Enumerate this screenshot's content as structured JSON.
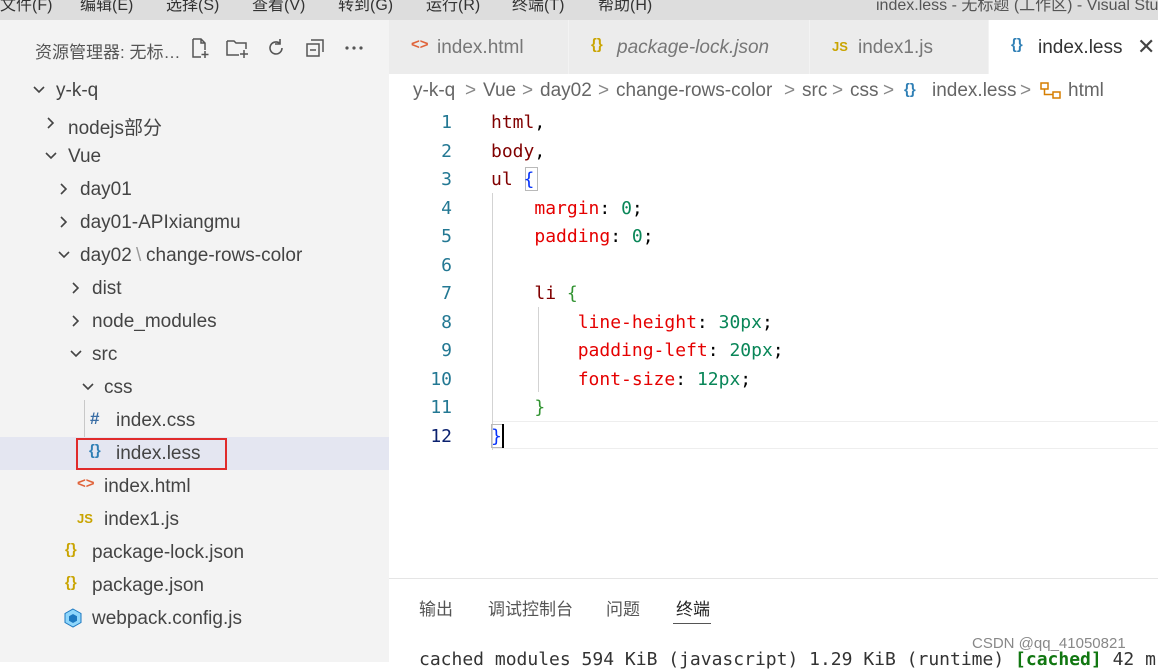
{
  "menubar": {
    "items": [
      "文件(F)",
      "编辑(E)",
      "选择(S)",
      "查看(V)",
      "转到(G)",
      "运行(R)",
      "终端(T)",
      "帮助(H)"
    ],
    "window_title": "index.less - 无标题 (工作区) - Visual Studio Code"
  },
  "explorer": {
    "title": "资源管理器: 无标…",
    "actions": [
      "new-file",
      "new-folder",
      "refresh",
      "collapse-all",
      "more"
    ],
    "tree": [
      {
        "label": "y-k-q",
        "type": "folder",
        "expanded": true
      },
      {
        "label": "nodejs部分",
        "type": "folder",
        "expanded": false
      },
      {
        "label": "Vue",
        "type": "folder",
        "expanded": true
      },
      {
        "label": "day01",
        "type": "folder",
        "expanded": false
      },
      {
        "label": "day01-APIxiangmu",
        "type": "folder",
        "expanded": false
      },
      {
        "label": "day02",
        "label_suffix": "change-rows-color",
        "type": "folder",
        "expanded": true
      },
      {
        "label": "dist",
        "type": "folder",
        "expanded": false
      },
      {
        "label": "node_modules",
        "type": "folder",
        "expanded": false
      },
      {
        "label": "src",
        "type": "folder",
        "expanded": true
      },
      {
        "label": "css",
        "type": "folder",
        "expanded": true
      },
      {
        "label": "index.css",
        "type": "file",
        "icon": "#"
      },
      {
        "label": "index.less",
        "type": "file",
        "icon": "{}",
        "selected": true
      },
      {
        "label": "index.html",
        "type": "file",
        "icon": "<>"
      },
      {
        "label": "index1.js",
        "type": "file",
        "icon": "JS"
      },
      {
        "label": "package-lock.json",
        "type": "file",
        "icon": "{}"
      },
      {
        "label": "package.json",
        "type": "file",
        "icon": "{}"
      },
      {
        "label": "webpack.config.js",
        "type": "file",
        "icon": "webpack"
      }
    ]
  },
  "tabs": [
    {
      "label": "index.html",
      "icon": "<>",
      "active": false
    },
    {
      "label": "package-lock.json",
      "icon": "{}",
      "active": false
    },
    {
      "label": "index1.js",
      "icon": "JS",
      "active": false
    },
    {
      "label": "index.less",
      "icon": "{}",
      "active": true,
      "close": "✕"
    }
  ],
  "breadcrumb": [
    "y-k-q",
    "Vue",
    "day02",
    "change-rows-color",
    "src",
    "css",
    "index.less",
    "html"
  ],
  "breadcrumb_icons": {
    "file": "{}",
    "symbol": "symbol-class"
  },
  "editor": {
    "lines": [
      {
        "n": "1",
        "tokens": [
          [
            "sel",
            "html"
          ],
          [
            "pun",
            ","
          ]
        ]
      },
      {
        "n": "2",
        "tokens": [
          [
            "sel",
            "body"
          ],
          [
            "pun",
            ","
          ]
        ]
      },
      {
        "n": "3",
        "tokens": [
          [
            "sel",
            "ul"
          ],
          [
            "pun",
            " "
          ],
          [
            "br1",
            "{"
          ]
        ]
      },
      {
        "n": "4",
        "tokens": [
          [
            "pun",
            "    "
          ],
          [
            "prop",
            "margin"
          ],
          [
            "pun",
            ": "
          ],
          [
            "num",
            "0"
          ],
          [
            "pun",
            ";"
          ]
        ]
      },
      {
        "n": "5",
        "tokens": [
          [
            "pun",
            "    "
          ],
          [
            "prop",
            "padding"
          ],
          [
            "pun",
            ": "
          ],
          [
            "num",
            "0"
          ],
          [
            "pun",
            ";"
          ]
        ]
      },
      {
        "n": "6",
        "tokens": []
      },
      {
        "n": "7",
        "tokens": [
          [
            "pun",
            "    "
          ],
          [
            "sel",
            "li"
          ],
          [
            "pun",
            " "
          ],
          [
            "br2",
            "{"
          ]
        ]
      },
      {
        "n": "8",
        "tokens": [
          [
            "pun",
            "        "
          ],
          [
            "prop",
            "line-height"
          ],
          [
            "pun",
            ": "
          ],
          [
            "num",
            "30px"
          ],
          [
            "pun",
            ";"
          ]
        ]
      },
      {
        "n": "9",
        "tokens": [
          [
            "pun",
            "        "
          ],
          [
            "prop",
            "padding-left"
          ],
          [
            "pun",
            ": "
          ],
          [
            "num",
            "20px"
          ],
          [
            "pun",
            ";"
          ]
        ]
      },
      {
        "n": "10",
        "tokens": [
          [
            "pun",
            "        "
          ],
          [
            "prop",
            "font-size"
          ],
          [
            "pun",
            ": "
          ],
          [
            "num",
            "12px"
          ],
          [
            "pun",
            ";"
          ]
        ]
      },
      {
        "n": "11",
        "tokens": [
          [
            "pun",
            "    "
          ],
          [
            "br2",
            "}"
          ]
        ]
      },
      {
        "n": "12",
        "tokens": [
          [
            "br1",
            "}"
          ]
        ],
        "current": true
      }
    ]
  },
  "panel": {
    "tabs": [
      "输出",
      "调试控制台",
      "问题",
      "终端"
    ],
    "active_tab": "终端",
    "terminal": {
      "text": "cached modules 594 KiB (javascript) 1.29 KiB (runtime) ",
      "highlight": "[cached]",
      "tail": " 42 m"
    }
  },
  "watermark": "CSDN @qq_41050821",
  "colors": {
    "selector": "#800000",
    "property": "#e50000",
    "number": "#098658",
    "bracket1": "#0431fa",
    "bracket2": "#319331",
    "selection_outline": "#e02b2b"
  }
}
